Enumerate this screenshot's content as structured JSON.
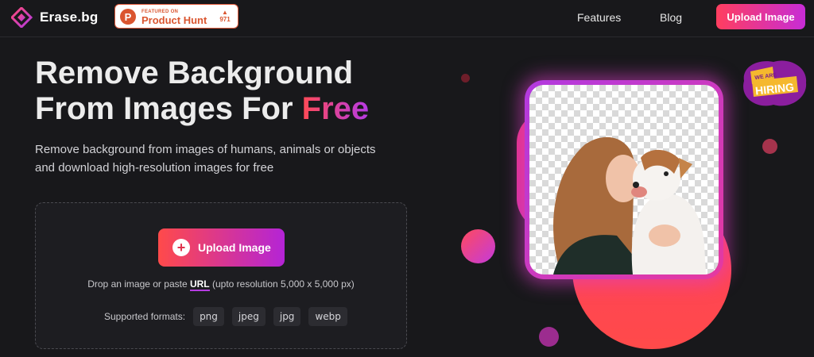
{
  "brand": {
    "name": "Erase.bg"
  },
  "product_hunt": {
    "featured_label": "FEATURED ON",
    "name": "Product Hunt",
    "votes": "971"
  },
  "nav": {
    "features": "Features",
    "blog": "Blog",
    "upload_button": "Upload Image"
  },
  "hero": {
    "title_line1": "Remove Background",
    "title_line2": "From Images For",
    "title_highlight": "Free",
    "subtitle_line1": "Remove background from images of humans, animals or objects",
    "subtitle_line2": "and download high-resolution images for free"
  },
  "upload": {
    "button_label": "Upload Image",
    "drop_text_before": "Drop an image or paste",
    "drop_link": "URL",
    "drop_text_after": "(upto resolution 5,000 x 5,000 px)",
    "formats_label": "Supported formats:",
    "formats": [
      "png",
      "jpeg",
      "jpg",
      "webp"
    ]
  },
  "hiring": {
    "line1": "WE ARE",
    "line2": "HIRING"
  },
  "colors": {
    "accent_start": "#ff3e5f",
    "accent_end": "#c72cd6",
    "background": "#18181b"
  }
}
